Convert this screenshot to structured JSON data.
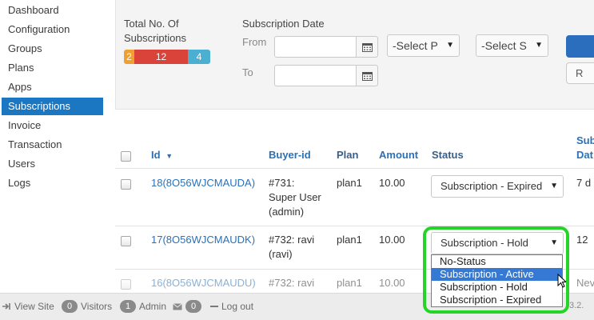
{
  "sidebar": {
    "items": [
      {
        "label": "Dashboard"
      },
      {
        "label": "Configuration"
      },
      {
        "label": "Groups"
      },
      {
        "label": "Plans"
      },
      {
        "label": "Apps"
      },
      {
        "label": "Subscriptions"
      },
      {
        "label": "Invoice"
      },
      {
        "label": "Transaction"
      },
      {
        "label": "Users"
      },
      {
        "label": "Logs"
      }
    ],
    "active": "Subscriptions"
  },
  "filter": {
    "total_label_line1": "Total No. Of",
    "total_label_line2": "Subscriptions",
    "counts": [
      "2",
      "12",
      "4"
    ],
    "date_heading": "Subscription Date",
    "from_label": "From",
    "to_label": "To",
    "from_value": "",
    "to_value": "",
    "plan_select": "-Select P",
    "status_select": "-Select S",
    "reset_label_partial": "R"
  },
  "table": {
    "columns": {
      "id": "Id",
      "buyer": "Buyer-id",
      "plan": "Plan",
      "amount": "Amount",
      "status": "Status",
      "sub_date_line1": "Sub",
      "sub_date_line2": "Dat"
    },
    "rows": [
      {
        "id": "18(8O56WJCMAUDA)",
        "buyer_line1": "#731:",
        "buyer_line2": "Super User",
        "buyer_line3": "(admin)",
        "plan": "plan1",
        "amount": "10.00",
        "status": "Subscription - Expired",
        "date_partial": "7 d"
      },
      {
        "id": "17(8O56WJCMAUDK)",
        "buyer_line1": "#732: ravi",
        "buyer_line2": "(ravi)",
        "plan": "plan1",
        "amount": "10.00",
        "status": "Subscription - Hold",
        "date_partial": "12"
      },
      {
        "id": "16(8O56WJCMAUDU)",
        "buyer_line1": "#732: ravi",
        "plan": "plan1",
        "amount": "10.00",
        "date_partial": "Nev"
      }
    ]
  },
  "status_dropdown": {
    "options": [
      "No-Status",
      "Subscription - Active",
      "Subscription - Hold",
      "Subscription - Expired"
    ],
    "highlighted": "Subscription - Active"
  },
  "footer": {
    "view_site": "View Site",
    "visitors_count": "0",
    "visitors_label": "Visitors",
    "admin_count": "1",
    "admin_label": "Admin",
    "messages_count": "0",
    "logout": "Log out",
    "version_partial": "3.2."
  },
  "colors": {
    "accent": "#1c77c3",
    "highlight_ring": "#24d427",
    "dropdown_selected": "#3579d4"
  }
}
